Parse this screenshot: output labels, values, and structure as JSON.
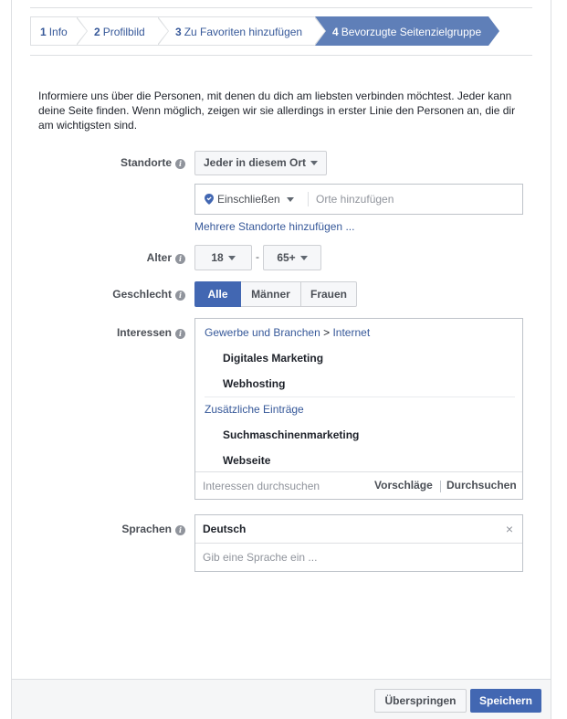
{
  "steps": [
    {
      "num": "1",
      "label": "Info"
    },
    {
      "num": "2",
      "label": "Profilbild"
    },
    {
      "num": "3",
      "label": "Zu Favoriten hinzufügen"
    },
    {
      "num": "4",
      "label": "Bevorzugte Seitenzielgruppe"
    }
  ],
  "intro": "Informiere uns über die Personen, mit denen du dich am liebsten verbinden möchtest. Jeder kann deine Seite finden. Wenn möglich, zeigen wir sie allerdings in erster Linie den Personen an, die dir am wichtigsten sind.",
  "locations": {
    "label": "Standorte",
    "scope_value": "Jeder in diesem Ort",
    "include_value": "Einschließen",
    "input_placeholder": "Orte hinzufügen",
    "add_more_link": "Mehrere Standorte hinzufügen ..."
  },
  "age": {
    "label": "Alter",
    "min": "18",
    "separator": "-",
    "max": "65+"
  },
  "gender": {
    "label": "Geschlecht",
    "options": [
      "Alle",
      "Männer",
      "Frauen"
    ],
    "selected": "Alle"
  },
  "interests": {
    "label": "Interessen",
    "category": "Gewerbe und Branchen",
    "category_sep": ">",
    "subcategory": "Internet",
    "items": [
      "Digitales Marketing",
      "Webhosting"
    ],
    "extra_header": "Zusätzliche Einträge",
    "extra_items": [
      "Suchmaschinenmarketing",
      "Webseite"
    ],
    "search_placeholder": "Interessen durchsuchen",
    "suggestions_label": "Vorschläge",
    "browse_label": "Durchsuchen"
  },
  "languages": {
    "label": "Sprachen",
    "selected": "Deutsch",
    "remove_glyph": "×",
    "input_placeholder": "Gib eine Sprache ein ..."
  },
  "footer": {
    "skip_label": "Überspringen",
    "save_label": "Speichern"
  },
  "colors": {
    "primary": "#4267b2",
    "active_step": "#5f7fb8",
    "link": "#365899"
  }
}
